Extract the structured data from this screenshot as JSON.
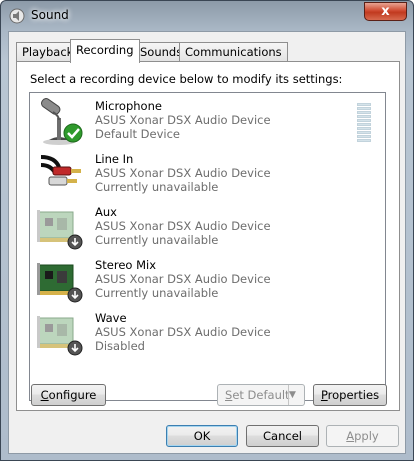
{
  "window": {
    "title": "Sound",
    "close_glyph": "x"
  },
  "tabs": [
    {
      "label": "Playback",
      "active": false
    },
    {
      "label": "Recording",
      "active": true
    },
    {
      "label": "Sounds",
      "active": false
    },
    {
      "label": "Communications",
      "active": false
    }
  ],
  "instruction": "Select a recording device below to modify its settings:",
  "devices": [
    {
      "name": "Microphone",
      "description": "ASUS Xonar DSX Audio Device",
      "status": "Default Device",
      "icon": "microphone-icon",
      "badge": "default-check-badge",
      "selected": false
    },
    {
      "name": "Line In",
      "description": "ASUS Xonar DSX Audio Device",
      "status": "Currently unavailable",
      "icon": "rca-cable-icon",
      "badge": "",
      "selected": false
    },
    {
      "name": "Aux",
      "description": "ASUS Xonar DSX Audio Device",
      "status": "Currently unavailable",
      "icon": "sound-card-icon",
      "badge": "unavailable-arrow-badge",
      "selected": false
    },
    {
      "name": "Stereo Mix",
      "description": "ASUS Xonar DSX Audio Device",
      "status": "Currently unavailable",
      "icon": "sound-card-icon",
      "badge": "unavailable-arrow-badge",
      "selected": false
    },
    {
      "name": "Wave",
      "description": "ASUS Xonar DSX Audio Device",
      "status": "Disabled",
      "icon": "sound-card-icon",
      "badge": "disabled-arrow-badge",
      "selected": false
    }
  ],
  "level_meter": {
    "segments": 10,
    "level": 0
  },
  "buttons": {
    "configure": {
      "prefix": "",
      "accel": "C",
      "rest": "onfigure"
    },
    "set_default": {
      "prefix": "",
      "accel": "S",
      "rest": "et Default",
      "enabled": false
    },
    "properties": {
      "prefix": "",
      "accel": "P",
      "rest": "roperties"
    },
    "ok": "OK",
    "cancel": "Cancel",
    "apply": {
      "accel": "A",
      "rest": "pply",
      "enabled": false
    }
  },
  "colors": {
    "accent_default_button": "#3c7fb1",
    "close_button": "#c13a1f",
    "check_badge": "#2f9a2c"
  }
}
